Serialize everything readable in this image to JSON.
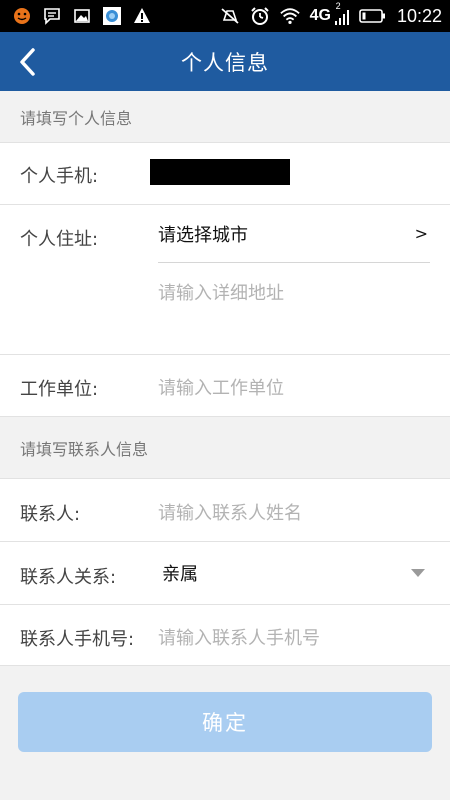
{
  "status_bar": {
    "network": "4G",
    "signal_sup": "2",
    "time": "10:22",
    "icons": [
      "face-icon",
      "message-icon",
      "image-icon",
      "app-icon",
      "warning-icon",
      "mute-icon",
      "alarm-icon",
      "wifi-icon",
      "signal-icon",
      "battery-icon"
    ]
  },
  "header": {
    "title": "个人信息",
    "back_icon": "chevron-left-icon"
  },
  "sections": {
    "personal": "请填写个人信息",
    "contact": "请填写联系人信息"
  },
  "form": {
    "phone": {
      "label": "个人手机:"
    },
    "address": {
      "label": "个人住址:",
      "city_value": "请选择城市",
      "city_arrow": ">",
      "detail_placeholder": "请输入详细地址"
    },
    "workplace": {
      "label": "工作单位:",
      "placeholder": "请输入工作单位"
    },
    "contact_name": {
      "label": "联系人:",
      "placeholder": "请输入联系人姓名"
    },
    "relation": {
      "label": "联系人关系:",
      "value": "亲属"
    },
    "contact_phone": {
      "label": "联系人手机号:",
      "placeholder": "请输入联系人手机号"
    }
  },
  "confirm_label": "确定",
  "colors": {
    "header_bg": "#1f5ba0",
    "page_bg": "#f2f2f2",
    "button_bg": "#a9cdf1",
    "placeholder": "#b3b3b3"
  }
}
